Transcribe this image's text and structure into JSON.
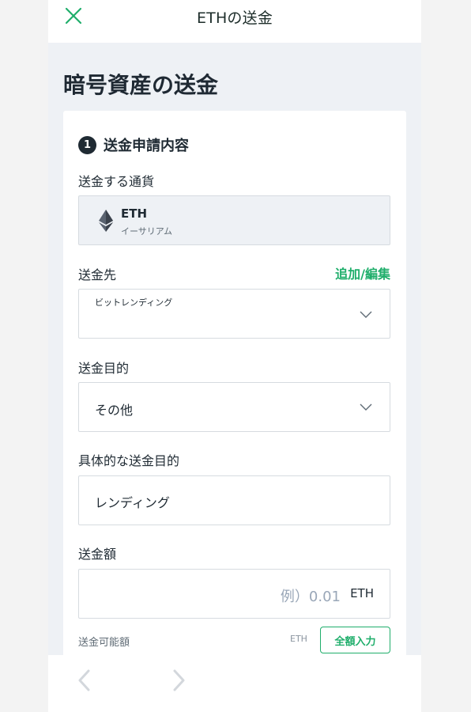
{
  "header": {
    "title": "ETHの送金",
    "close_icon": "close-icon",
    "accent": "#1fae6b"
  },
  "page": {
    "title": "暗号資産の送金"
  },
  "form": {
    "step_number": "1",
    "section_title": "送金申請内容",
    "currency": {
      "label": "送金する通貨",
      "code": "ETH",
      "name": "イーサリアム",
      "icon": "ethereum-icon"
    },
    "destination": {
      "label": "送金先",
      "add_edit_link": "追加/編集",
      "small_label": "ビットレンディング",
      "value": ""
    },
    "purpose": {
      "label": "送金目的",
      "value": "その他"
    },
    "specific_purpose": {
      "label": "具体的な送金目的",
      "value": "レンディング"
    },
    "amount": {
      "label": "送金額",
      "placeholder": "例）0.01",
      "unit": "ETH"
    },
    "available": {
      "label": "送金可能額",
      "unit": "ETH",
      "full_amount_button": "全額入力"
    }
  },
  "bottom_nav": {
    "back_icon": "chevron-left-icon",
    "forward_icon": "chevron-right-icon"
  }
}
